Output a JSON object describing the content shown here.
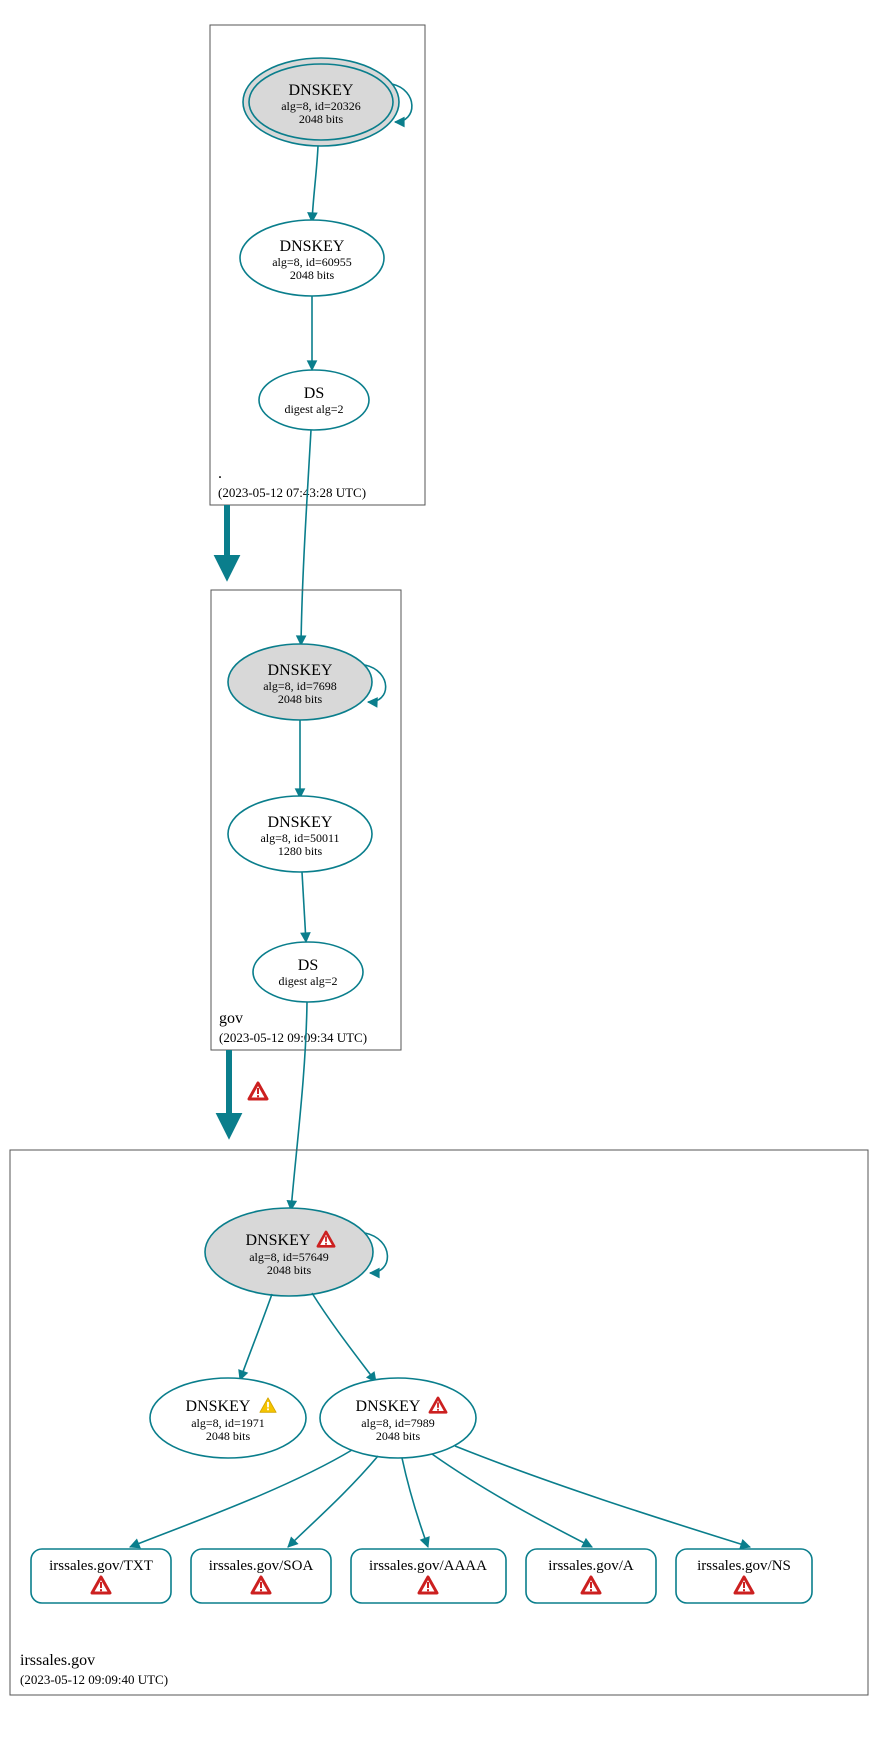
{
  "colors": {
    "accent": "#0a7e8c",
    "node_fill": "#d8d8d8",
    "box_stroke": "#555555",
    "error": "#cc2020",
    "warn": "#f5c400"
  },
  "zones": {
    "root": {
      "label": ".",
      "timestamp": "(2023-05-12 07:43:28 UTC)"
    },
    "gov": {
      "label": "gov",
      "timestamp": "(2023-05-12 09:09:34 UTC)"
    },
    "leaf": {
      "label": "irssales.gov",
      "timestamp": "(2023-05-12 09:09:40 UTC)"
    }
  },
  "nodes": {
    "root_ksk": {
      "title": "DNSKEY",
      "line1": "alg=8, id=20326",
      "line2": "2048 bits"
    },
    "root_zsk": {
      "title": "DNSKEY",
      "line1": "alg=8, id=60955",
      "line2": "2048 bits"
    },
    "root_ds": {
      "title": "DS",
      "line1": "digest alg=2"
    },
    "gov_ksk": {
      "title": "DNSKEY",
      "line1": "alg=8, id=7698",
      "line2": "2048 bits"
    },
    "gov_zsk": {
      "title": "DNSKEY",
      "line1": "alg=8, id=50011",
      "line2": "1280 bits"
    },
    "gov_ds": {
      "title": "DS",
      "line1": "digest alg=2"
    },
    "leaf_ksk": {
      "title": "DNSKEY",
      "line1": "alg=8, id=57649",
      "line2": "2048 bits"
    },
    "leaf_zsk_a": {
      "title": "DNSKEY",
      "line1": "alg=8, id=1971",
      "line2": "2048 bits"
    },
    "leaf_zsk_b": {
      "title": "DNSKEY",
      "line1": "alg=8, id=7989",
      "line2": "2048 bits"
    }
  },
  "rrsets": {
    "txt": {
      "label": "irssales.gov/TXT"
    },
    "soa": {
      "label": "irssales.gov/SOA"
    },
    "aaaa": {
      "label": "irssales.gov/AAAA"
    },
    "a": {
      "label": "irssales.gov/A"
    },
    "ns": {
      "label": "irssales.gov/NS"
    }
  }
}
